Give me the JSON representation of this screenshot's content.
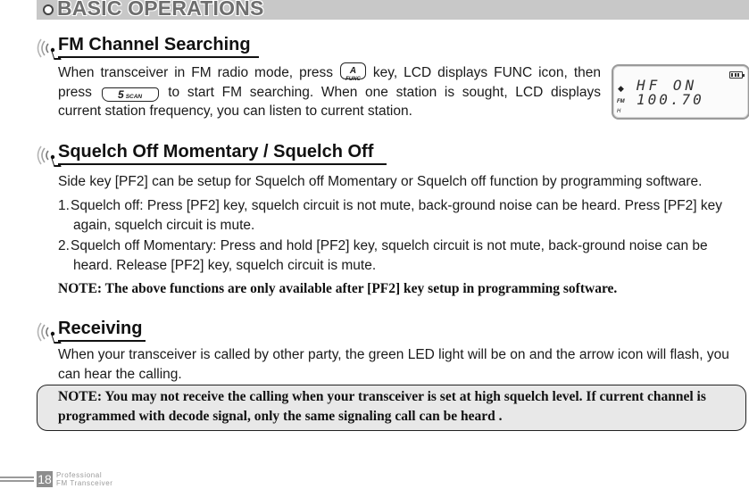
{
  "banner": {
    "title": "BASIC OPERATIONS"
  },
  "sections": {
    "fm": {
      "heading": "FM Channel Searching",
      "text_parts": [
        "When transceiver in FM radio mode, press ",
        " key, LCD displays FUNC icon, then press ",
        " to start FM searching. When one station is sought, LCD displays current station frequency, you can listen to current station."
      ],
      "key_func": {
        "top": "A",
        "bottom": "FUNC"
      },
      "key_scan": {
        "main": "5",
        "sub": "SCAN"
      },
      "lcd": {
        "line1": "HF ON",
        "line2": "100.70",
        "indicator_fm": "FM",
        "indicator_h": "H",
        "arrow": "◆"
      }
    },
    "squelch": {
      "heading": "Squelch Off Momentary / Squelch Off",
      "intro": "Side key [PF2] can be setup for Squelch off Momentary or Squelch off function by programming software.",
      "items": [
        {
          "num": "1.",
          "text": "Squelch off: Press [PF2] key, squelch circuit is not mute, back-ground noise can be heard. Press [PF2] key again, squelch circuit is mute."
        },
        {
          "num": "2.",
          "text": "Squelch off Momentary: Press and hold [PF2] key, squelch circuit is not mute, back-ground noise can be heard. Release [PF2] key, squelch circuit is mute."
        }
      ],
      "note": "NOTE: The above functions are only available after [PF2] key setup in programming software."
    },
    "receiving": {
      "heading": "Receiving",
      "text": "When your transceiver is called by other party, the green LED light will be on and the arrow icon will flash, you can hear the calling.",
      "note": "NOTE: You may not receive the calling when your transceiver is set at high squelch level. If current channel is programmed with decode signal, only the same signaling call can be heard ."
    }
  },
  "footer": {
    "page_number": "18",
    "line1": "Professional",
    "line2": "FM Transceiver"
  }
}
